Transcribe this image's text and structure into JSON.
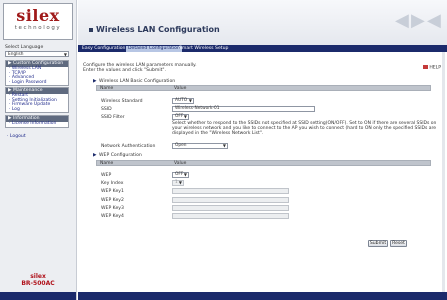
{
  "sidebar": {
    "logo_text": "silex",
    "logo_sub": "technology",
    "language_label": "Select Language",
    "language_value": "English",
    "menu_groups": [
      {
        "title": "Custom Configuration",
        "items": [
          "Wireless LAN",
          "TCP/IP",
          "Advanced",
          "Login Password"
        ]
      },
      {
        "title": "Maintenance",
        "items": [
          "Restart",
          "Setting Initialization",
          "Firmware Update",
          "Log"
        ]
      },
      {
        "title": "Information",
        "items": [
          "License Information"
        ]
      }
    ],
    "logout_label": "Logout",
    "brand": "silex",
    "model": "BR-500AC"
  },
  "header": {
    "title": "Wireless LAN Configuration"
  },
  "tabs": [
    {
      "label": "Easy Configuration",
      "active": false
    },
    {
      "label": "Detailed Configuration",
      "active": true
    },
    {
      "label": "Smart Wireless Setup",
      "active": false
    }
  ],
  "main": {
    "instruction_line1": "Configure the wireless LAN parameters manually.",
    "instruction_line2": "Enter the values and click \"Submit\".",
    "help_label": "HELP",
    "basic": {
      "section_title": "Wireless LAN Basic Configuration",
      "col_name": "Name",
      "col_value": "Value",
      "wireless_standard_label": "Wireless Standard",
      "wireless_standard_value": "AUTO",
      "ssid_label": "SSID",
      "ssid_value": "Wireless-Network-01",
      "ssid_filter_label": "SSID Filter",
      "ssid_filter_value": "OFF",
      "ssid_filter_desc": "Select whether to respond to the SSIDs not specified at SSID setting(ON/OFF). Set to ON if there are several SSIDs on your wireless network and you like to connect to the AP you wish to connect (hard to ON only the specified SSIDs are displayed in the \"Wireless Network List\".",
      "network_auth_label": "Network Authentication",
      "network_auth_value": "Open"
    },
    "wep": {
      "section_title": "WEP Configuration",
      "col_name": "Name",
      "col_value": "Value",
      "wep_label": "WEP",
      "wep_value": "OFF",
      "key_index_label": "Key Index",
      "key_index_value": "1",
      "key_labels": [
        "WEP Key1",
        "WEP Key2",
        "WEP Key3",
        "WEP Key4"
      ]
    },
    "submit_label": "Submit",
    "reset_label": "Reset"
  },
  "colors": {
    "brand_red": "#a01a1a",
    "nav_blue": "#1b2a6b",
    "link_blue": "#1f2a8a",
    "table_header_gray": "#bfc4cc"
  }
}
